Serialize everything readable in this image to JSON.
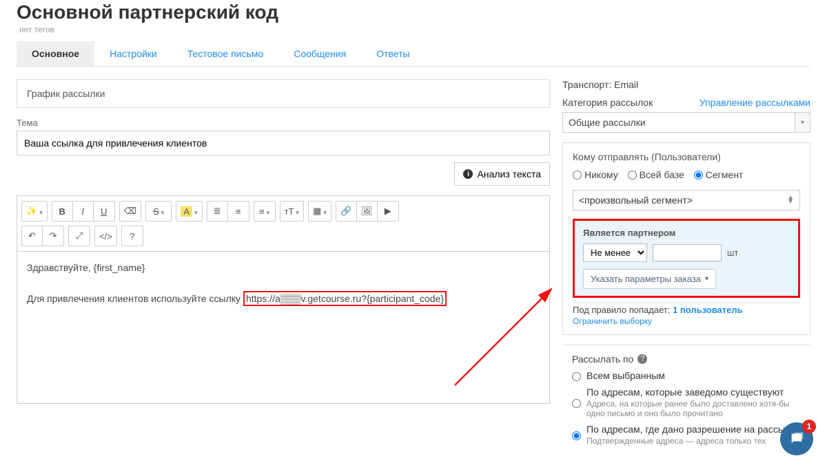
{
  "page": {
    "title": "Основной партнерский код",
    "tags_label": "нет тегов"
  },
  "tabs": [
    "Основное",
    "Настройки",
    "Тестовое письмо",
    "Сообщения",
    "Ответы"
  ],
  "active_tab_index": 0,
  "schedule": {
    "header": "График рассылки"
  },
  "subject": {
    "label": "Тема",
    "value": "Ваша ссылка для привлечения клиентов"
  },
  "analyze": {
    "label": "Анализ текста"
  },
  "editor": {
    "greeting_line": "Здравствуйте, {first_name}",
    "body_prefix": "Для привлечения клиентов используйте ссылку ",
    "link_text": "https://a▒▒▒v.getcourse.ru?{participant_code}"
  },
  "toolbar_labels": {
    "bold": "B",
    "italic": "I",
    "underline": "U",
    "font_a": "A",
    "text_size": "тТ"
  },
  "side": {
    "transport_label": "Транспорт:",
    "transport_value": "Email",
    "category_label": "Категория рассылок",
    "manage_link": "Управление рассылками",
    "category_value": "Общие рассылки",
    "recipients_title": "Кому отправлять (Пользователи)",
    "radio_nobody": "Никому",
    "radio_all": "Всей базе",
    "radio_segment": "Сегмент",
    "segment_value": "<произвольный сегмент>",
    "partner": {
      "title": "Является партнером",
      "cmp_value": "Не менее",
      "unit": "шт",
      "order_params": "Указать параметры заказа"
    },
    "rule_match_prefix": "Под правило попадает: ",
    "rule_match_link": "1 пользователь",
    "limit_link": "Ограничить выборку",
    "send_by_title": "Рассылать по",
    "opt_all": "Всем выбранным",
    "opt_known": "По адресам, которые заведомо существуют",
    "opt_known_desc": "Адреса, на которые ранее было доставлено хотя-бы одно письмо и оно было прочитано",
    "opt_allowed": "По адресам, где дано разрешение на рассылки",
    "opt_allowed_desc": "Подтвержденные адреса — адреса только тех"
  },
  "chat": {
    "badge": "1"
  },
  "colors": {
    "accent": "#1f8ceb",
    "callout": "#e11",
    "chat": "#2f6ea3",
    "highlight_box_bg": "#e9f4fb"
  }
}
